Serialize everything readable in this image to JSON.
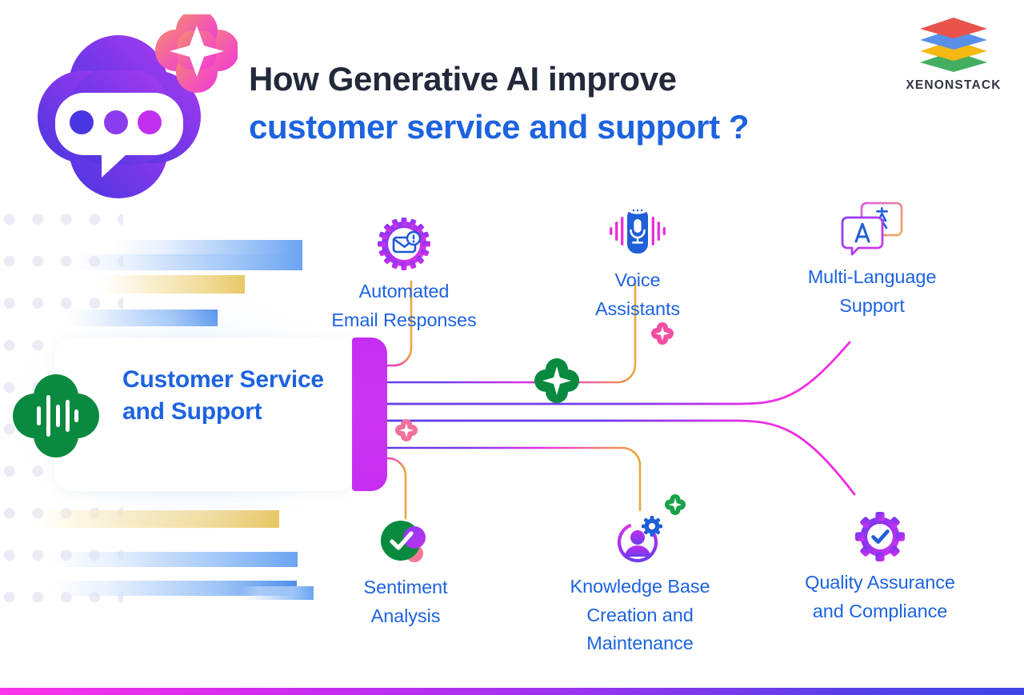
{
  "header": {
    "title_line1": "How Generative AI improve",
    "title_line2": "customer service and support ?",
    "title_color_line1": "#22293a",
    "title_color_line2": "#1d63e0",
    "logo_icon": "chatbot-speech-bubble-icon",
    "sparkle_icon": "sparkle-icon"
  },
  "brand": {
    "name": "XENONSTACK",
    "logo_icon": "stacked-layers-icon",
    "layer_colors": [
      "#e8453c",
      "#4a87e8",
      "#f4b400",
      "#34a853"
    ]
  },
  "center": {
    "title": "Customer Service and Support",
    "icon": "green-waveform-quatrefoil-icon",
    "icon_color": "#0a8a3f",
    "edge_color": "#c62ef0",
    "text_color": "#1d63e0"
  },
  "nodes": [
    {
      "id": "automated-email-responses",
      "label_line1": "Automated",
      "label_line2": "Email Responses",
      "icon": "gear-envelope-alert-icon",
      "position": "top-left"
    },
    {
      "id": "voice-assistants",
      "label_line1": "Voice",
      "label_line2": "Assistants",
      "icon": "smart-speaker-microphone-icon",
      "position": "top-center"
    },
    {
      "id": "multi-language-support",
      "label_line1": "Multi-Language",
      "label_line2": "Support",
      "icon": "translation-speech-bubbles-icon",
      "position": "top-right"
    },
    {
      "id": "sentiment-analysis",
      "label_line1": "Sentiment",
      "label_line2": "Analysis",
      "icon": "green-check-circle-icon",
      "position": "bottom-left"
    },
    {
      "id": "knowledge-base-creation-and-maintenance",
      "label_line1": "Knowledge Base",
      "label_line2": "Creation and",
      "label_line3": "Maintenance",
      "icon": "user-gear-circle-icon",
      "position": "bottom-center"
    },
    {
      "id": "quality-assurance-and-compliance",
      "label_line1": "Quality Assurance",
      "label_line2": "and Compliance",
      "icon": "gear-checkmark-icon",
      "position": "bottom-right"
    }
  ],
  "decorations": {
    "sparkles": [
      "green-sparkle-large",
      "pink-sparkle-small",
      "pink-sparkle-small",
      "green-sparkle-small"
    ],
    "dot_grid_color": "#ecebf5",
    "bottom_bar_gradient": [
      "#fb34e8",
      "#3f46e6"
    ]
  },
  "colors": {
    "accent_blue": "#1d63e0",
    "accent_magenta": "#c62ef0",
    "accent_green": "#0a8a3f",
    "dark_text": "#22293a"
  }
}
